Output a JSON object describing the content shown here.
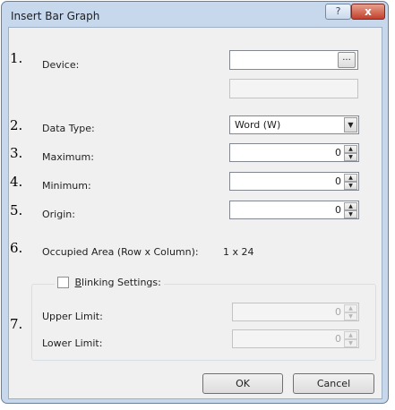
{
  "window": {
    "title": "Insert Bar Graph",
    "help_label": "?",
    "close_label": "x"
  },
  "numbers": [
    "1.",
    "2.",
    "3.",
    "4.",
    "5.",
    "6.",
    "7."
  ],
  "device": {
    "label": "Device:",
    "value": "",
    "browse_label": "...",
    "secondary_value": ""
  },
  "data_type": {
    "label": "Data Type:",
    "selected": "Word (W)"
  },
  "maximum": {
    "label": "Maximum:",
    "value": "0"
  },
  "minimum": {
    "label": "Minimum:",
    "value": "0"
  },
  "origin": {
    "label": "Origin:",
    "value": "0"
  },
  "occupied_area": {
    "label": "Occupied Area (Row x Column):",
    "value": "1 x 24"
  },
  "blinking": {
    "label_underlined": "B",
    "label_rest": "linking Settings:",
    "checked": false,
    "upper_limit": {
      "label": "Upper Limit:",
      "value": "0"
    },
    "lower_limit": {
      "label": "Lower Limit:",
      "value": "0"
    }
  },
  "buttons": {
    "ok": "OK",
    "cancel": "Cancel"
  }
}
